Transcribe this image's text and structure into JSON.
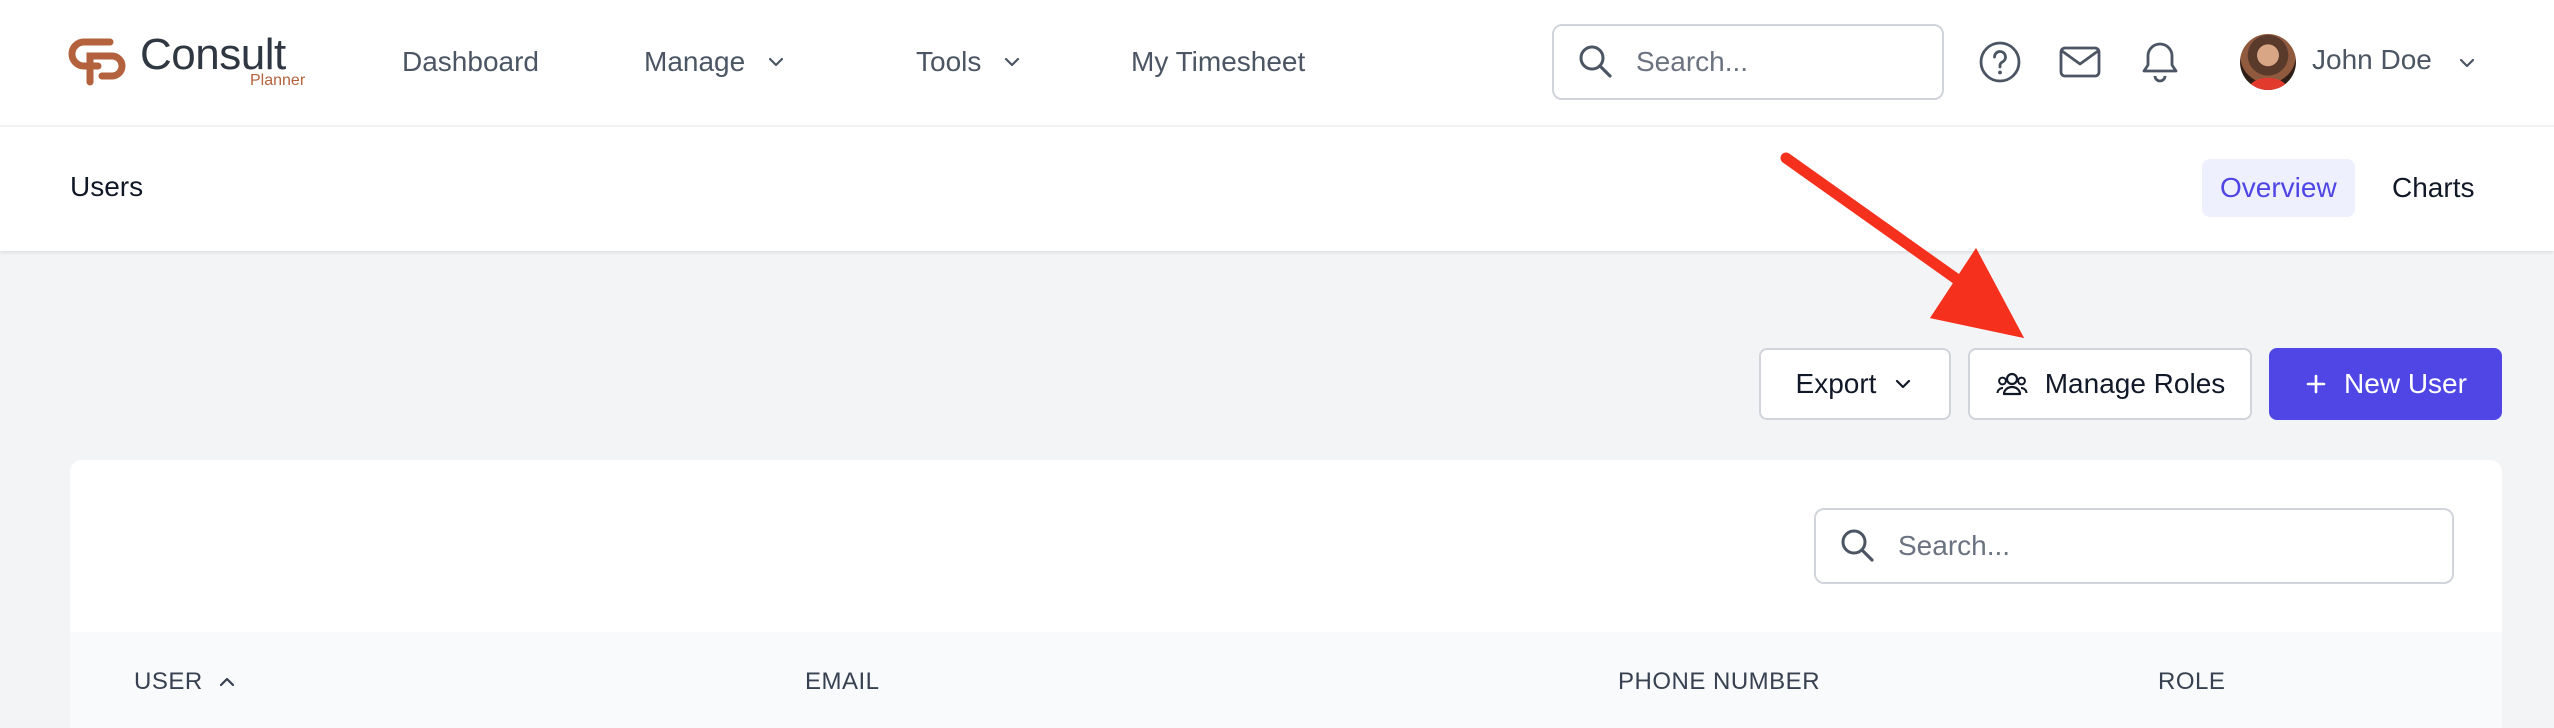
{
  "app": {
    "logo_text": "Consult",
    "logo_subtext": "Planner"
  },
  "nav": {
    "dashboard": "Dashboard",
    "manage": "Manage",
    "tools": "Tools",
    "my_timesheet": "My Timesheet"
  },
  "header": {
    "search_placeholder": "Search...",
    "user_name": "John Doe",
    "icons": [
      "help-circle-icon",
      "mail-icon",
      "bell-icon"
    ]
  },
  "page": {
    "title": "Users",
    "tabs": [
      {
        "label": "Overview",
        "active": true
      },
      {
        "label": "Charts",
        "active": false
      }
    ]
  },
  "actions": {
    "export_label": "Export",
    "manage_roles_label": "Manage Roles",
    "new_user_label": "New User"
  },
  "table": {
    "search_placeholder": "Search...",
    "columns": [
      "USER",
      "EMAIL",
      "PHONE NUMBER",
      "ROLE"
    ],
    "sort_column": "USER",
    "sort_direction": "ascending"
  },
  "colors": {
    "primary": "#4f46e5",
    "primary_tint": "#eef0fe",
    "logo_accent": "#b4623d",
    "annotation_arrow": "#f5301d",
    "background": "#f3f4f6"
  }
}
